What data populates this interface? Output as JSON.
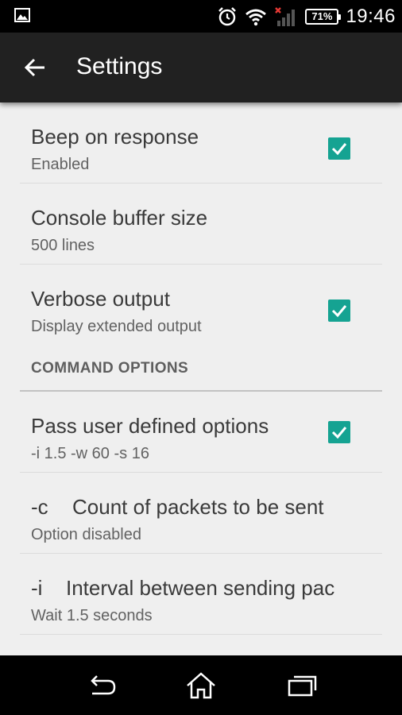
{
  "status_bar": {
    "battery": "71%",
    "time": "19:46",
    "icons": [
      "photo-icon",
      "alarm-icon",
      "wifi-icon",
      "signal-icon",
      "battery-icon"
    ]
  },
  "app_bar": {
    "title": "Settings",
    "back_icon": "arrow-back-icon"
  },
  "prefs": [
    {
      "title": "Beep on response",
      "summary": "Enabled",
      "checked": true
    },
    {
      "title": "Console buffer size",
      "summary": "500 lines"
    },
    {
      "title": "Verbose output",
      "summary": "Display extended output",
      "checked": true
    }
  ],
  "category": {
    "title": "COMMAND OPTIONS"
  },
  "command_prefs": [
    {
      "title": "Pass user defined options",
      "summary": "-i 1.5 -w 60 -s 16",
      "checked": true
    },
    {
      "flag": "-c",
      "title": "Count of packets to be sent",
      "summary": "Option disabled"
    },
    {
      "flag": "-i",
      "title": "Interval between sending pac",
      "summary": "Wait 1.5 seconds"
    }
  ],
  "nav_bar": {
    "icons": [
      "back-nav-icon",
      "home-icon",
      "recents-icon"
    ]
  },
  "colors": {
    "accent": "#15a392",
    "app_bar": "#212121",
    "background": "#efefef"
  }
}
